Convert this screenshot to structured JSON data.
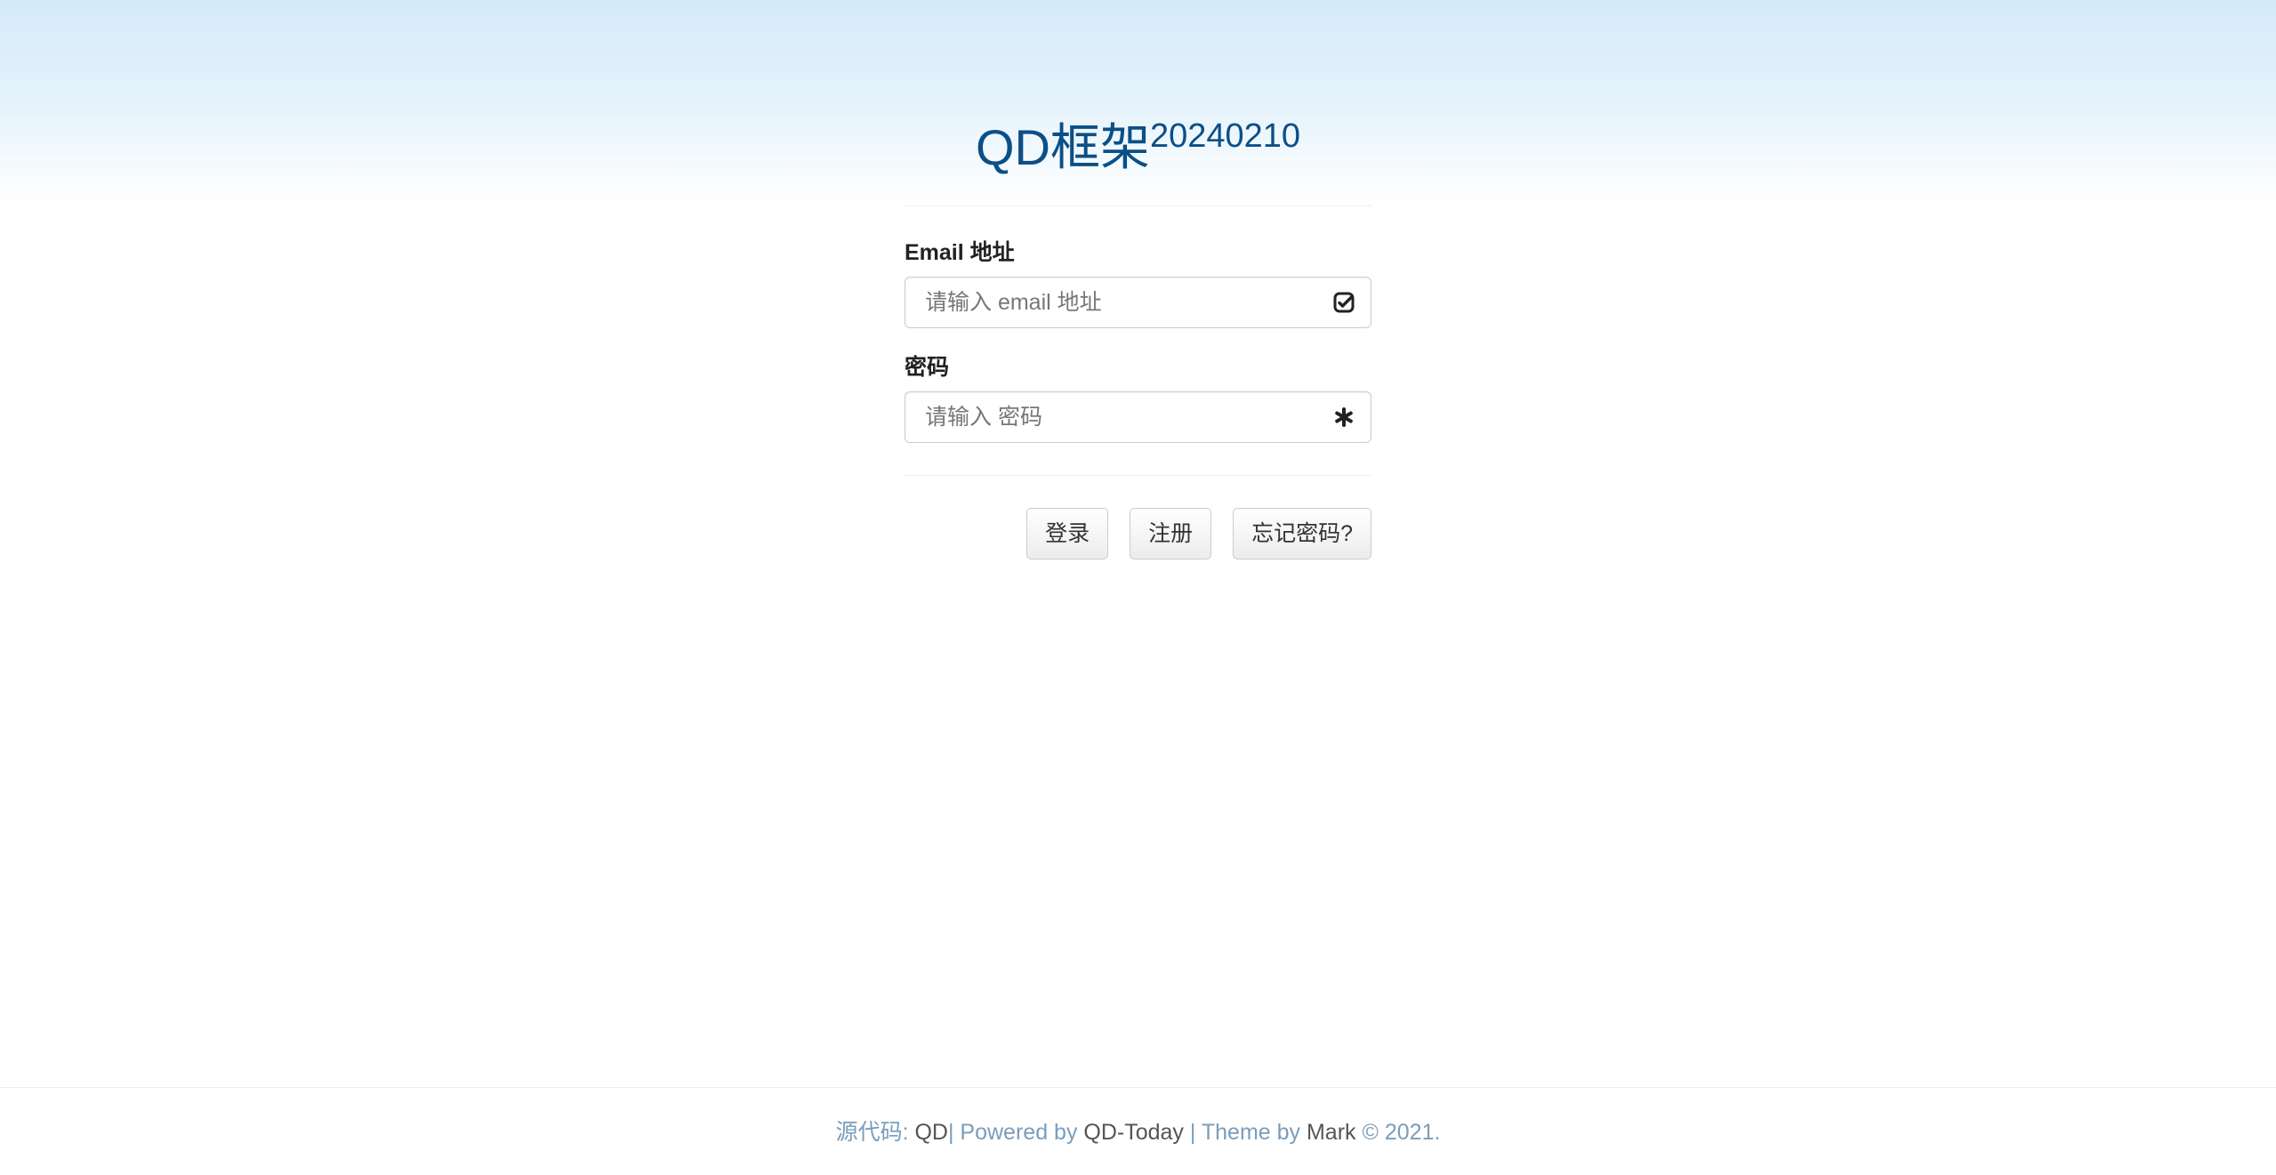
{
  "header": {
    "title": "QD框架",
    "version": "20240210"
  },
  "form": {
    "email": {
      "label": "Email 地址",
      "placeholder": "请输入 email 地址",
      "value": "",
      "icon": "check-square-icon"
    },
    "password": {
      "label": "密码",
      "placeholder": "请输入 密码",
      "value": "",
      "icon": "asterisk-icon"
    },
    "buttons": {
      "login": "登录",
      "register": "注册",
      "forgot": "忘记密码?"
    }
  },
  "footer": {
    "source_prefix": "源代码: ",
    "source_link": "QD",
    "powered_prefix": "| Powered by ",
    "powered_link": "QD-Today",
    "theme_prefix": " | Theme by ",
    "theme_link": "Mark",
    "copyright": " © 2021."
  },
  "colors": {
    "title": "#0b4f87",
    "footer_text": "#7a9dbb",
    "footer_link": "#555555",
    "header_gradient_top": "#d4eaf8"
  }
}
